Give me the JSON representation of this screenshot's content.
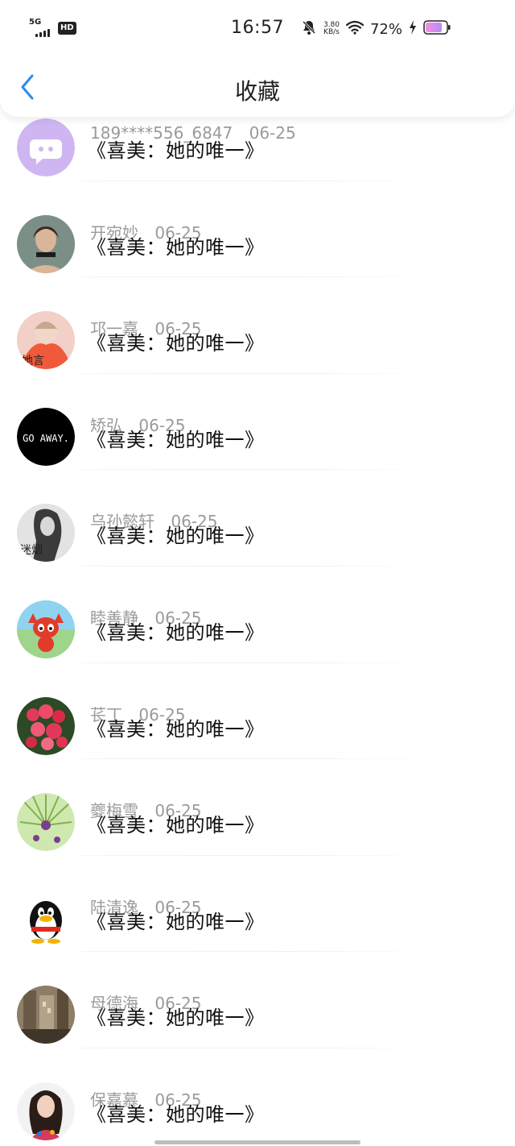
{
  "status_bar": {
    "network": "5G",
    "hd": "HD",
    "time": "16:57",
    "speed_value": "3.80",
    "speed_unit": "KB/s",
    "battery_percent": "72%"
  },
  "nav": {
    "title": "收藏"
  },
  "list": {
    "items": [
      {
        "user": "189****556_6847",
        "date": "06-25",
        "title": "《喜美：她的唯一》"
      },
      {
        "user": "开宛妙",
        "date": "06-25",
        "title": "《喜美：她的唯一》"
      },
      {
        "user": "邛一嘉",
        "date": "06-25",
        "title": "《喜美：她的唯一》"
      },
      {
        "user": "矫弘",
        "date": "06-25",
        "title": "《喜美：她的唯一》"
      },
      {
        "user": "乌孙懿轩",
        "date": "06-25",
        "title": "《喜美：她的唯一》"
      },
      {
        "user": "睦善静",
        "date": "06-25",
        "title": "《喜美：她的唯一》"
      },
      {
        "user": "苌丁",
        "date": "06-25",
        "title": "《喜美：她的唯一》"
      },
      {
        "user": "夔梅雪",
        "date": "06-25",
        "title": "《喜美：她的唯一》"
      },
      {
        "user": "陆清逸",
        "date": "06-25",
        "title": "《喜美：她的唯一》"
      },
      {
        "user": "母德海",
        "date": "06-25",
        "title": "《喜美：她的唯一》"
      },
      {
        "user": "保嘉慕",
        "date": "06-25",
        "title": "《喜美：她的唯一》"
      }
    ]
  },
  "avatar_texts": {
    "a3": "她言",
    "a4": "GO AWAY.",
    "a5": "迷烟"
  },
  "colors": {
    "accent": "#2a8cf0",
    "title_text": "#111111",
    "meta_text": "#9a9a9a"
  }
}
